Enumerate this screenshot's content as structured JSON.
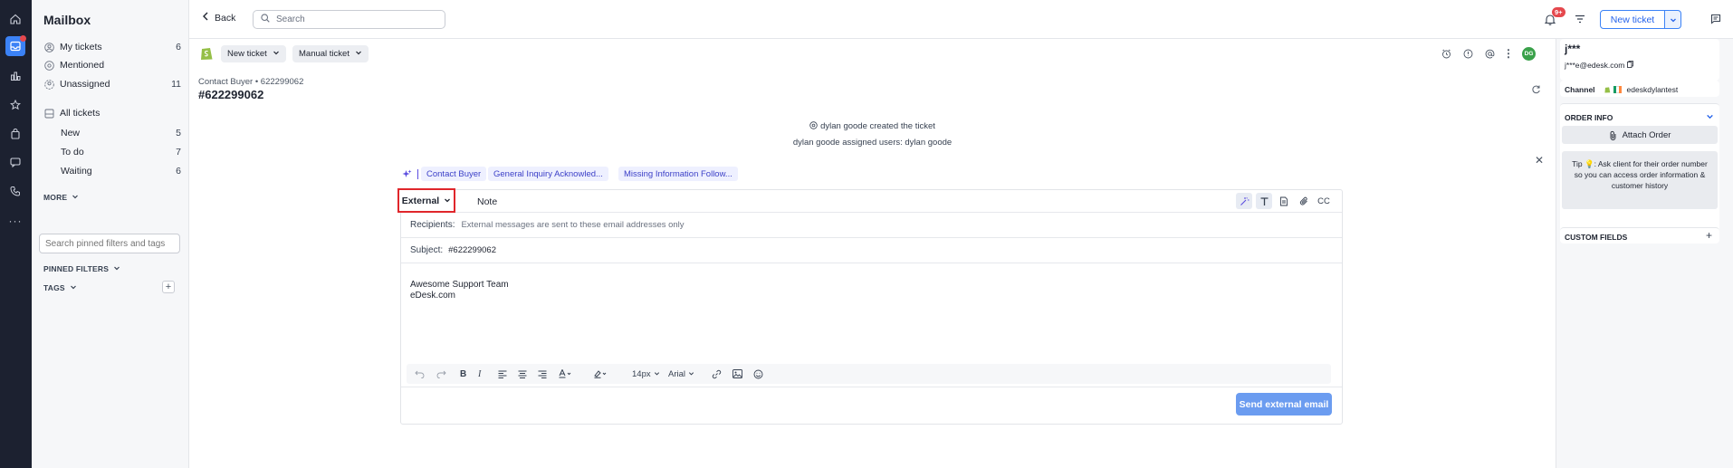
{
  "rail": {
    "icons": [
      "home-icon",
      "inbox-icon",
      "chart-icon",
      "star-icon",
      "bag-icon",
      "chat-icon",
      "phone-icon",
      "more-icon"
    ]
  },
  "sidebar": {
    "title": "Mailbox",
    "items": [
      {
        "label": "My tickets",
        "count": "6"
      },
      {
        "label": "Mentioned",
        "count": ""
      },
      {
        "label": "Unassigned",
        "count": "11"
      }
    ],
    "all_tickets": "All tickets",
    "sub_items": [
      {
        "label": "New",
        "count": "5"
      },
      {
        "label": "To do",
        "count": "7"
      },
      {
        "label": "Waiting",
        "count": "6"
      }
    ],
    "more_label": "MORE",
    "search_placeholder": "Search pinned filters and tags",
    "pinned_filters": "PINNED FILTERS",
    "tags": "TAGS"
  },
  "topbar": {
    "back_label": "Back",
    "search_placeholder": "Search",
    "notif_badge": "9+",
    "new_ticket_label": "New ticket"
  },
  "ticket": {
    "new_ticket_chip": "New ticket",
    "manual_ticket_chip": "Manual ticket",
    "breadcrumb": "Contact Buyer • 622299062",
    "title": "#622299062",
    "avatar_initials": "DG",
    "activity": [
      "dylan goode created the ticket",
      "dylan goode assigned users: dylan goode"
    ],
    "ai_tags": [
      "Contact Buyer",
      "General Inquiry Acknowled...",
      "Missing Information Follow..."
    ]
  },
  "composer": {
    "mode_external": "External",
    "mode_note": "Note",
    "cc_label": "CC",
    "recipients_label": "Recipients:",
    "recipients_hint": "External messages are sent to these email addresses only",
    "subject_label": "Subject:",
    "subject_value": "#622299062",
    "body_line1": "Awesome Support Team",
    "body_line2": "eDesk.com",
    "font_size": "14px",
    "font_family": "Arial",
    "send_label": "Send external email"
  },
  "right_panel": {
    "contact_name": "j***",
    "contact_email": "j***e@edesk.com",
    "channel_label": "Channel",
    "channel_value": "edeskdylantest",
    "order_info": "ORDER INFO",
    "attach_order": "Attach Order",
    "tip_prefix": "Tip",
    "tip_text": ": Ask client for their order number so you can access order information & customer history",
    "custom_fields": "CUSTOM FIELDS"
  },
  "colors": {
    "accent": "#3b82f6",
    "highlight": "#e0262b",
    "rail": "#1c2130",
    "send": "#6b9cf0"
  }
}
